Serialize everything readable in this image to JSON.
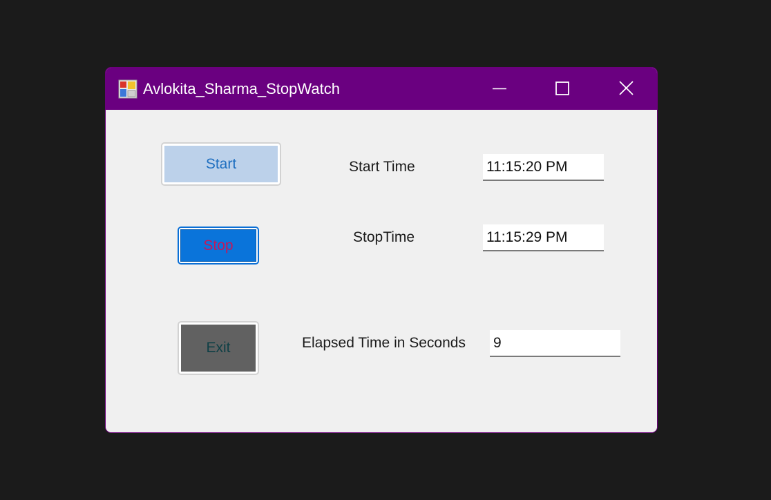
{
  "window": {
    "title": "Avlokita_Sharma_StopWatch",
    "title_bar_color": "#6a0080"
  },
  "caption_buttons": {
    "minimize_icon": "minimize-icon",
    "maximize_icon": "maximize-icon",
    "close_icon": "close-icon"
  },
  "buttons": {
    "start_label": "Start",
    "stop_label": "Stop",
    "exit_label": "Exit"
  },
  "labels": {
    "start_time": "Start Time",
    "stop_time": "StopTime",
    "elapsed": "Elapsed Time in Seconds"
  },
  "fields": {
    "start_time_value": "11:15:20 PM",
    "stop_time_value": "11:15:29 PM",
    "elapsed_value": "9"
  },
  "colors": {
    "start_button_face": "#bcd1ea",
    "stop_button_face": "#0a74da",
    "stop_button_text": "#c2185b",
    "exit_button_face": "#616161"
  }
}
